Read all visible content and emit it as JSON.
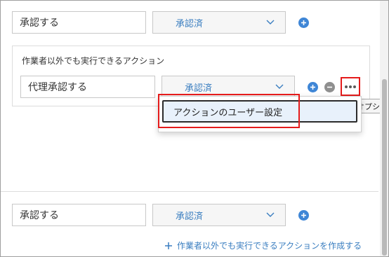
{
  "rows": [
    {
      "action": "承認する",
      "status": "承認済"
    },
    {
      "action": "代理承認する",
      "status": "承認済"
    },
    {
      "action": "承認する",
      "status": "承認済"
    }
  ],
  "panel": {
    "title": "作業者以外でも実行できるアクション"
  },
  "tooltip": {
    "text": "オプション"
  },
  "menu": {
    "items": [
      {
        "label": "アクションのユーザー設定"
      }
    ]
  },
  "create_link": {
    "label": "作業者以外でも実行できるアクションを作成する"
  },
  "icons": {
    "add": "plus-circle-icon",
    "remove": "minus-circle-icon",
    "options": "more-horizontal-icon",
    "select": "chevron-down-icon"
  },
  "colors": {
    "accent": "#3f86d6",
    "link": "#3a7ec0",
    "highlight": "#e51b1b",
    "menu_hover": "#e8f1fb"
  }
}
